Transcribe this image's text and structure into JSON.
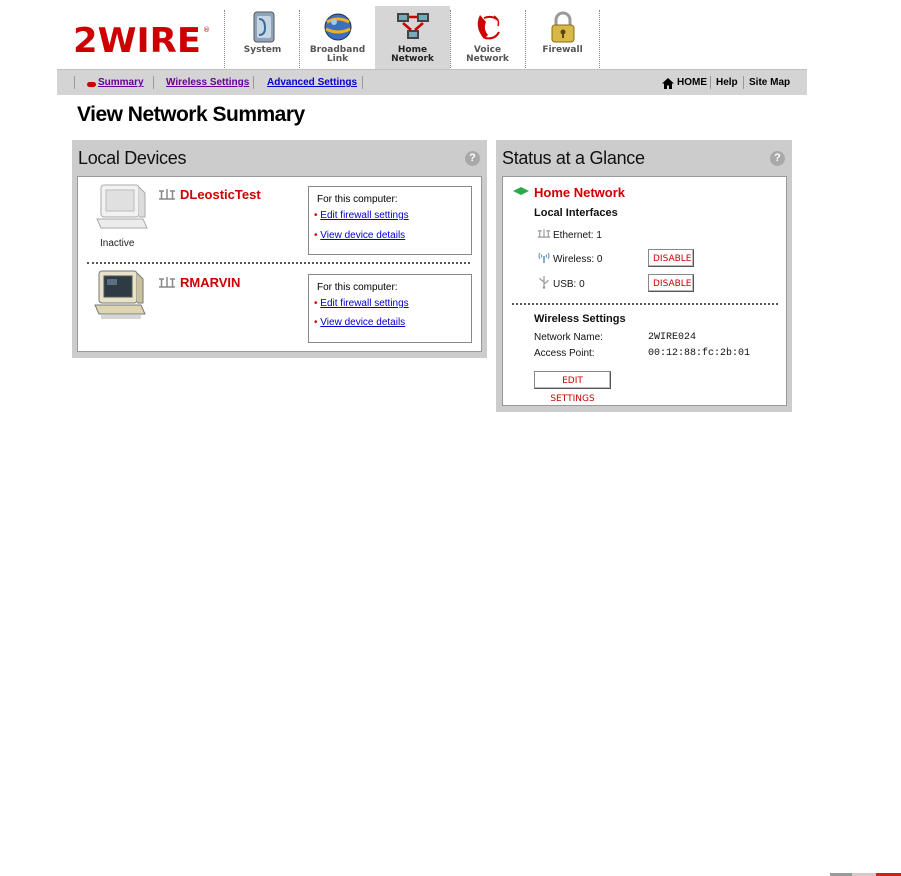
{
  "brand": {
    "logo_text": "2WIRE"
  },
  "topnav": {
    "tabs": [
      {
        "key": "system",
        "label_lines": [
          "System"
        ],
        "icon": "system-icon",
        "active": false
      },
      {
        "key": "broadband",
        "label_lines": [
          "Broadband",
          "Link"
        ],
        "icon": "globe-icon",
        "active": false
      },
      {
        "key": "home",
        "label_lines": [
          "Home",
          "Network"
        ],
        "icon": "home-network-icon",
        "active": true
      },
      {
        "key": "voice",
        "label_lines": [
          "Voice",
          "Network"
        ],
        "icon": "telephone-icon",
        "active": false
      },
      {
        "key": "firewall",
        "label_lines": [
          "Firewall"
        ],
        "icon": "padlock-icon",
        "active": false
      }
    ]
  },
  "subnav": {
    "links": [
      "Summary",
      "Wireless Settings",
      "Advanced Settings"
    ],
    "right_links": [
      "HOME",
      "Help",
      "Site Map"
    ]
  },
  "page": {
    "title": "View Network Summary"
  },
  "local_devices": {
    "title": "Local Devices",
    "help": "?",
    "devices": [
      {
        "name": "DLeosticTest",
        "status": "Inactive",
        "for_label": "For this computer:",
        "links": [
          "Edit firewall settings",
          "View device details"
        ]
      },
      {
        "name": "RMARVIN",
        "status": "",
        "for_label": "For this computer:",
        "links": [
          "Edit firewall settings",
          "View device details"
        ]
      }
    ]
  },
  "status": {
    "title": "Status at a Glance",
    "help": "?",
    "home_network": "Home Network",
    "local_interfaces": {
      "heading": "Local Interfaces",
      "ethernet": "Ethernet: 1",
      "wireless": "Wireless: 0",
      "usb": "USB: 0",
      "disable_label": "DISABLE"
    },
    "wireless_settings": {
      "heading": "Wireless Settings",
      "network_name_label": "Network Name:",
      "network_name": "2WIRE024",
      "access_point_label": "Access Point:",
      "access_point": "00:12:88:fc:2b:01",
      "edit_label": "EDIT SETTINGS"
    }
  },
  "colors": {
    "brand_red": "#cc0000",
    "tab_active": "#d6d6d6",
    "panel_gray": "#cccccc"
  }
}
